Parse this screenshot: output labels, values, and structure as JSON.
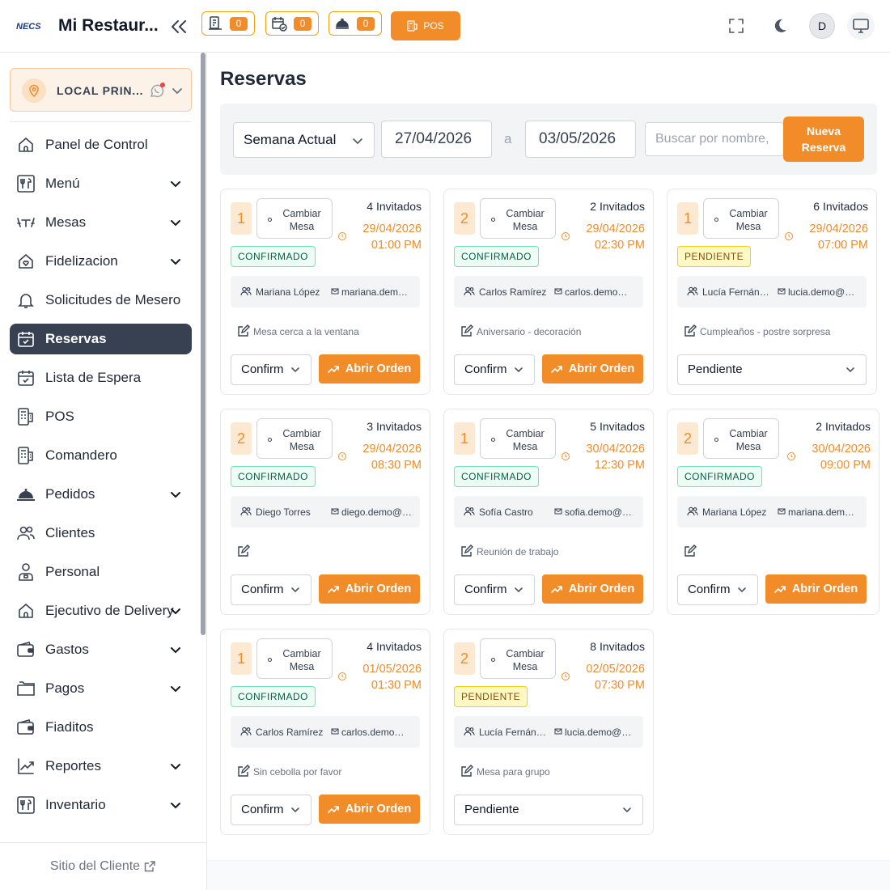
{
  "header": {
    "logo_text": "NECS",
    "title": "Mi Restaur...",
    "counters": [
      {
        "icon": "receipt-icon",
        "count": "0"
      },
      {
        "icon": "calendar-check-icon",
        "count": "0"
      },
      {
        "icon": "cloche-icon",
        "count": "0"
      }
    ],
    "pos_label": "POS",
    "avatar_initial": "D"
  },
  "sidebar": {
    "location_label": "LOCAL PRIN...",
    "items": [
      {
        "label": "Panel de Control",
        "icon": "home-icon",
        "chevron": false
      },
      {
        "label": "Menú",
        "icon": "utensils-icon",
        "chevron": true
      },
      {
        "label": "Mesas",
        "icon": "table-icon",
        "chevron": true
      },
      {
        "label": "Fidelizacion",
        "icon": "home-heart-icon",
        "chevron": true
      },
      {
        "label": "Solicitudes de Mesero",
        "icon": "bell-icon",
        "chevron": false
      },
      {
        "label": "Reservas",
        "icon": "calendar-check-icon",
        "chevron": false,
        "active": true
      },
      {
        "label": "Lista de Espera",
        "icon": "calendar-check-icon",
        "chevron": false
      },
      {
        "label": "POS",
        "icon": "pos-icon",
        "chevron": false
      },
      {
        "label": "Comandero",
        "icon": "pos-icon",
        "chevron": false
      },
      {
        "label": "Pedidos",
        "icon": "cloche-icon",
        "chevron": true
      },
      {
        "label": "Clientes",
        "icon": "users-icon",
        "chevron": false
      },
      {
        "label": "Personal",
        "icon": "person-badge-icon",
        "chevron": false
      },
      {
        "label": "Ejecutivo de Delivery",
        "icon": "home-icon",
        "chevron": true
      },
      {
        "label": "Gastos",
        "icon": "wallet-icon",
        "chevron": true
      },
      {
        "label": "Pagos",
        "icon": "folder-icon",
        "chevron": true
      },
      {
        "label": "Fiaditos",
        "icon": "wallet-icon",
        "chevron": false
      },
      {
        "label": "Reportes",
        "icon": "chart-icon",
        "chevron": true
      },
      {
        "label": "Inventario",
        "icon": "utensils-icon",
        "chevron": true
      }
    ],
    "client_site_label": "Sitio del Cliente"
  },
  "main": {
    "title": "Reservas",
    "filter": {
      "period": "Semana Actual",
      "date_from": "27/04/2026",
      "separator": "a",
      "date_to": "03/05/2026",
      "search_placeholder": "Buscar por nombre,",
      "new_button": "Nueva Reserva"
    },
    "change_table_label": "Cambiar Mesa",
    "open_order_label": "Abrir Orden",
    "reservations": [
      {
        "table": "1",
        "guests": "4 Invitados",
        "date": "29/04/2026",
        "time": "01:00 PM",
        "status": "CONFIRMADO",
        "name": "Mariana López",
        "email": "mariana.demo@correo.com",
        "note": "Mesa cerca a la ventana",
        "select_value": "Confirmado"
      },
      {
        "table": "2",
        "guests": "2 Invitados",
        "date": "29/04/2026",
        "time": "02:30 PM",
        "status": "CONFIRMADO",
        "name": "Carlos Ramírez",
        "email": "carlos.demo@correo.com",
        "note": "Aniversario - decoración",
        "select_value": "Confirmado"
      },
      {
        "table": "1",
        "guests": "6 Invitados",
        "date": "29/04/2026",
        "time": "07:00 PM",
        "status": "PENDIENTE",
        "name": "Lucía Fernández",
        "email": "lucia.demo@correo.com",
        "note": "Cumpleaños - postre sorpresa",
        "select_value": "Pendiente"
      },
      {
        "table": "2",
        "guests": "3 Invitados",
        "date": "29/04/2026",
        "time": "08:30 PM",
        "status": "CONFIRMADO",
        "name": "Diego Torres",
        "email": "diego.demo@correo.com",
        "note": "",
        "select_value": "Confirmado"
      },
      {
        "table": "1",
        "guests": "5 Invitados",
        "date": "30/04/2026",
        "time": "12:30 PM",
        "status": "CONFIRMADO",
        "name": "Sofía Castro",
        "email": "sofia.demo@correo.com",
        "note": "Reunión de trabajo",
        "select_value": "Confirmado"
      },
      {
        "table": "2",
        "guests": "2 Invitados",
        "date": "30/04/2026",
        "time": "09:00 PM",
        "status": "CONFIRMADO",
        "name": "Mariana López",
        "email": "mariana.demo@correo.com",
        "note": "",
        "select_value": "Confirmado"
      },
      {
        "table": "1",
        "guests": "4 Invitados",
        "date": "01/05/2026",
        "time": "01:30 PM",
        "status": "CONFIRMADO",
        "name": "Carlos Ramírez",
        "email": "carlos.demo@correo.com",
        "note": "Sin cebolla por favor",
        "select_value": "Confirmado"
      },
      {
        "table": "2",
        "guests": "8 Invitados",
        "date": "02/05/2026",
        "time": "07:30 PM",
        "status": "PENDIENTE",
        "name": "Lucía Fernández",
        "email": "lucia.demo@correo.com",
        "note": "Mesa para grupo",
        "select_value": "Pendiente"
      }
    ]
  },
  "colors": {
    "accent": "#f28c28",
    "sidebar_active": "#374151",
    "confirmed": "#065f46",
    "pending": "#854d0e"
  }
}
